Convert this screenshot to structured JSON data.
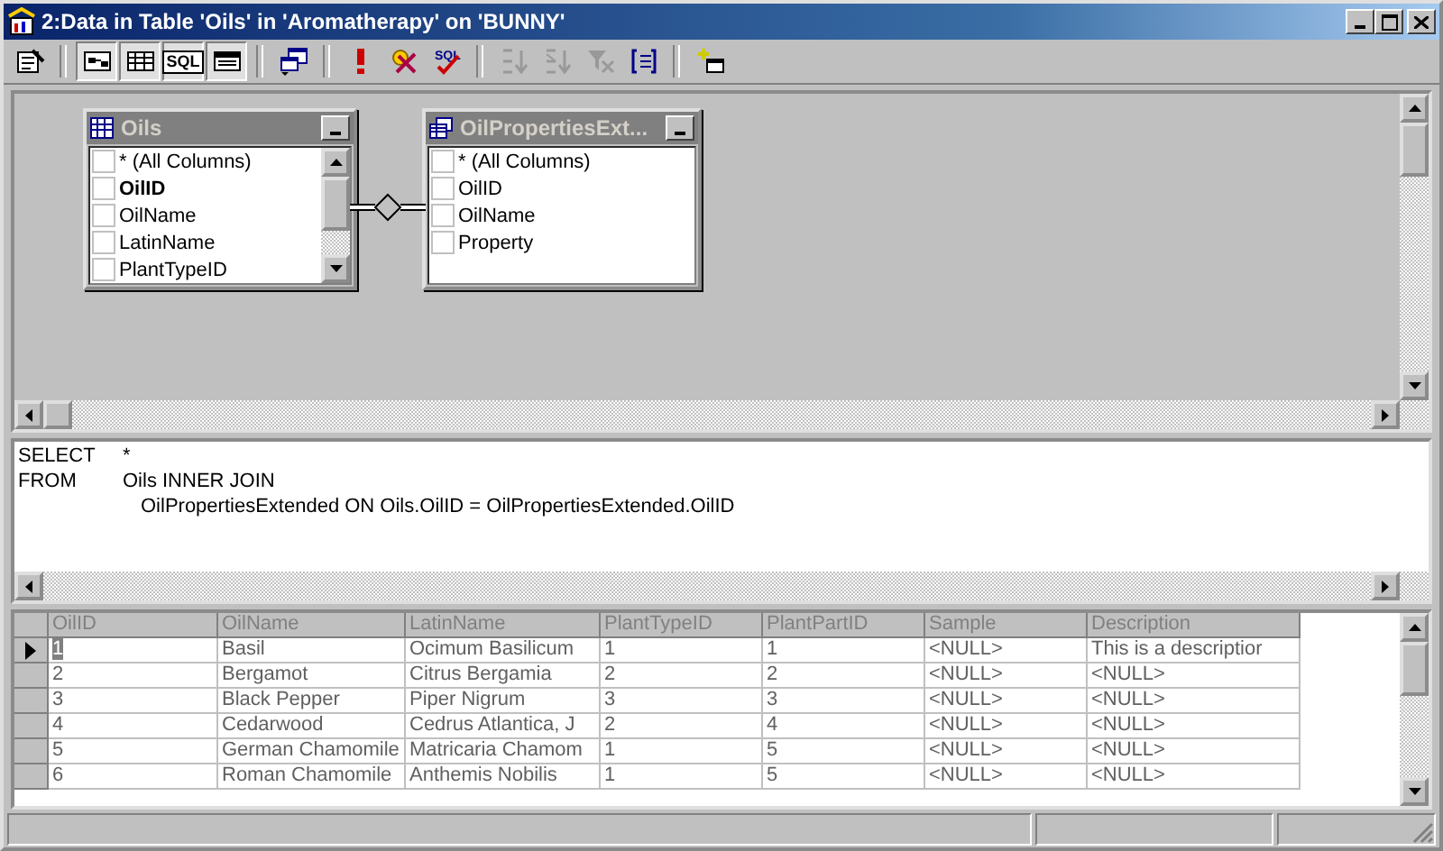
{
  "window": {
    "title": "2:Data in Table 'Oils' in 'Aromatherapy' on 'BUNNY'"
  },
  "toolbar": [
    {
      "kind": "properties",
      "pressed": false
    },
    {
      "kind": "separator"
    },
    {
      "kind": "diagram",
      "pressed": true
    },
    {
      "kind": "grid",
      "pressed": true
    },
    {
      "kind": "sql",
      "pressed": true,
      "label": "SQL"
    },
    {
      "kind": "results",
      "pressed": true
    },
    {
      "kind": "separator"
    },
    {
      "kind": "change-type",
      "pressed": false
    },
    {
      "kind": "separator"
    },
    {
      "kind": "run",
      "pressed": false
    },
    {
      "kind": "clear",
      "pressed": false
    },
    {
      "kind": "verify",
      "pressed": false,
      "label": "SQL"
    },
    {
      "kind": "separator"
    },
    {
      "kind": "sort-asc",
      "pressed": false,
      "disabled": true
    },
    {
      "kind": "sort-desc",
      "pressed": false,
      "disabled": true
    },
    {
      "kind": "remove-filter",
      "pressed": false,
      "disabled": true
    },
    {
      "kind": "group-by",
      "pressed": false
    },
    {
      "kind": "separator"
    },
    {
      "kind": "add-table",
      "pressed": false
    }
  ],
  "diagram": {
    "tables": [
      {
        "title": "Oils",
        "kind": "table",
        "scrollable": true,
        "columns": [
          {
            "name": "* (All Columns)",
            "key": false,
            "checked": false
          },
          {
            "name": "OilID",
            "key": true,
            "checked": false
          },
          {
            "name": "OilName",
            "key": false,
            "checked": false
          },
          {
            "name": "LatinName",
            "key": false,
            "checked": false
          },
          {
            "name": "PlantTypeID",
            "key": false,
            "checked": false
          }
        ]
      },
      {
        "title": "OilPropertiesExt...",
        "kind": "view",
        "scrollable": false,
        "columns": [
          {
            "name": "* (All Columns)",
            "key": false,
            "checked": false
          },
          {
            "name": "OilID",
            "key": false,
            "checked": false
          },
          {
            "name": "OilName",
            "key": false,
            "checked": false
          },
          {
            "name": "Property",
            "key": false,
            "checked": false
          }
        ]
      }
    ]
  },
  "sql": [
    {
      "kind": "clause",
      "keyword": "SELECT",
      "text": "*"
    },
    {
      "kind": "clause",
      "keyword": "FROM",
      "text": "Oils INNER JOIN"
    },
    {
      "kind": "continuation",
      "text": "OilPropertiesExtended ON Oils.OilID = OilPropertiesExtended.OilID"
    }
  ],
  "grid": {
    "columns": [
      "OilID",
      "OilName",
      "LatinName",
      "PlantTypeID",
      "PlantPartID",
      "Sample",
      "Description"
    ],
    "rows": [
      {
        "current": true,
        "cells": [
          "1",
          "Basil",
          "Ocimum Basilicum",
          "1",
          "1",
          "<NULL>",
          "This is a descriptior"
        ]
      },
      {
        "current": false,
        "cells": [
          "2",
          "Bergamot",
          "Citrus Bergamia",
          "2",
          "2",
          "<NULL>",
          "<NULL>"
        ]
      },
      {
        "current": false,
        "cells": [
          "3",
          "Black Pepper",
          "Piper Nigrum",
          "3",
          "3",
          "<NULL>",
          "<NULL>"
        ]
      },
      {
        "current": false,
        "cells": [
          "4",
          "Cedarwood",
          "Cedrus Atlantica, J",
          "2",
          "4",
          "<NULL>",
          "<NULL>"
        ]
      },
      {
        "current": false,
        "cells": [
          "5",
          "German Chamomile",
          "Matricaria Chamom",
          "1",
          "5",
          "<NULL>",
          "<NULL>"
        ]
      },
      {
        "current": false,
        "cells": [
          "6",
          "Roman Chamomile",
          "Anthemis Nobilis",
          "1",
          "5",
          "<NULL>",
          "<NULL>"
        ]
      }
    ]
  }
}
